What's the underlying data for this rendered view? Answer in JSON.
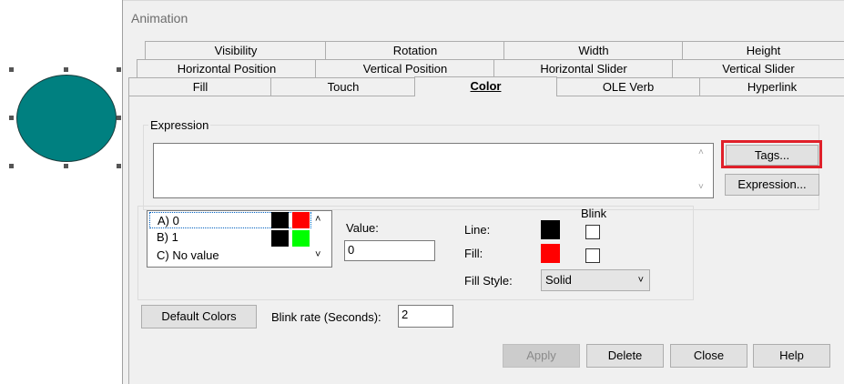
{
  "dialog": {
    "title": "Animation"
  },
  "tabs": {
    "row1": [
      "Visibility",
      "Rotation",
      "Width",
      "Height"
    ],
    "row2": [
      "Horizontal Position",
      "Vertical Position",
      "Horizontal Slider",
      "Vertical Slider"
    ],
    "row3": [
      "Fill",
      "Touch",
      "Color",
      "OLE Verb",
      "Hyperlink"
    ],
    "active": "Color"
  },
  "expression": {
    "group_label": "Expression",
    "value": "",
    "tags_button": "Tags...",
    "expression_button": "Expression..."
  },
  "color_list": {
    "items": [
      {
        "label": "A) 0",
        "line_color": "#000000",
        "fill_color": "#ff0000"
      },
      {
        "label": "B) 1",
        "line_color": "#000000",
        "fill_color": "#00ff00"
      },
      {
        "label": "C) No value"
      }
    ]
  },
  "value": {
    "label": "Value:",
    "value": "0"
  },
  "properties": {
    "blink_label": "Blink",
    "line_label": "Line:",
    "line_color": "#000000",
    "fill_label": "Fill:",
    "fill_color": "#ff0000",
    "fill_style_label": "Fill Style:",
    "fill_style_value": "Solid"
  },
  "bottom": {
    "default_colors_button": "Default Colors",
    "blink_rate_label": "Blink rate (Seconds):",
    "blink_rate_value": "2"
  },
  "actions": {
    "apply": "Apply",
    "delete": "Delete",
    "close": "Close",
    "help": "Help"
  },
  "shape": {
    "fill_color": "#008080"
  }
}
